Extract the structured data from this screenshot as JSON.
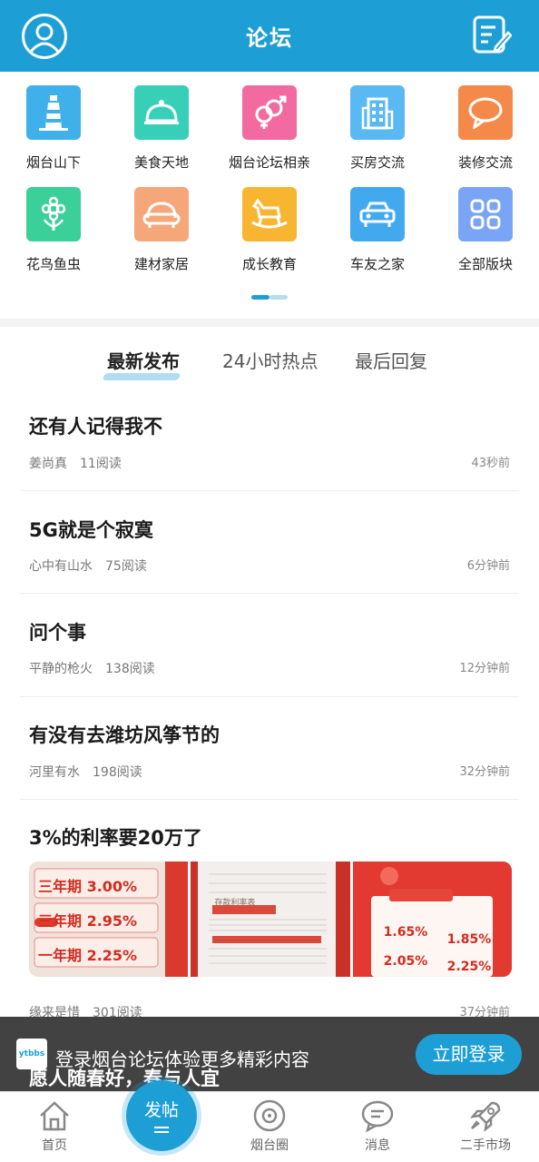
{
  "header": {
    "title": "论坛"
  },
  "categories": [
    {
      "label": "烟台山下",
      "color": "#3fb0ea",
      "icon": "lighthouse-icon"
    },
    {
      "label": "美食天地",
      "color": "#37cfb8",
      "icon": "food-cloche-icon"
    },
    {
      "label": "烟台论坛相亲",
      "color": "#f26aa0",
      "icon": "gender-icon"
    },
    {
      "label": "买房交流",
      "color": "#5ab8f2",
      "icon": "building-icon"
    },
    {
      "label": "装修交流",
      "color": "#f5894a",
      "icon": "chat-bubble-icon"
    },
    {
      "label": "花鸟鱼虫",
      "color": "#3bcf9a",
      "icon": "flower-icon"
    },
    {
      "label": "建材家居",
      "color": "#f5a77a",
      "icon": "sofa-icon"
    },
    {
      "label": "成长教育",
      "color": "#f8b531",
      "icon": "rocking-horse-icon"
    },
    {
      "label": "车友之家",
      "color": "#43a9ef",
      "icon": "car-icon"
    },
    {
      "label": "全部版块",
      "color": "#7aa4f5",
      "icon": "grid-icon"
    }
  ],
  "tabs": [
    {
      "label": "最新发布",
      "active": true
    },
    {
      "label": "24小时热点",
      "active": false
    },
    {
      "label": "最后回复",
      "active": false
    }
  ],
  "posts": [
    {
      "title": "还有人记得我不",
      "author": "姜尚真",
      "reads": "11阅读",
      "time": "43秒前"
    },
    {
      "title": "5G就是个寂寞",
      "author": "心中有山水",
      "reads": "75阅读",
      "time": "6分钟前"
    },
    {
      "title": "问个事",
      "author": "平静的枪火",
      "reads": "138阅读",
      "time": "12分钟前"
    },
    {
      "title": "有没有去潍坊风筝节的",
      "author": "河里有水",
      "reads": "198阅读",
      "time": "32分钟前"
    },
    {
      "title": "3%的利率要20万了",
      "author": "缘来是惜",
      "reads": "301阅读",
      "time": "37分钟前"
    }
  ],
  "post_images": [
    {
      "rows": [
        "三年期 3.00%",
        "三年期 2.95%",
        "一年期 2.25%"
      ]
    },
    {
      "rows": [
        "存款利率表"
      ]
    },
    {
      "rows": [
        "1.65%",
        "1.85%",
        "2.05%",
        "2.25%"
      ]
    }
  ],
  "banner": {
    "logo": "ytbbs",
    "text": "登录烟台论坛体验更多精彩内容",
    "button": "立即登录",
    "peek_title": "愿人随春好，春与人宜"
  },
  "nav": {
    "home": "首页",
    "post": "发帖",
    "circle": "烟台圈",
    "messages": "消息",
    "market": "二手市场"
  }
}
